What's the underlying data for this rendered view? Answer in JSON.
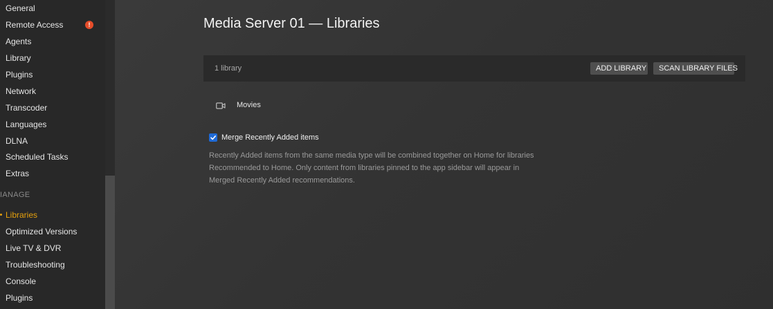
{
  "sidebar": {
    "items": [
      {
        "label": "General"
      },
      {
        "label": "Remote Access",
        "badge": "!"
      },
      {
        "label": "Agents"
      },
      {
        "label": "Library"
      },
      {
        "label": "Plugins"
      },
      {
        "label": "Network"
      },
      {
        "label": "Transcoder"
      },
      {
        "label": "Languages"
      },
      {
        "label": "DLNA"
      },
      {
        "label": "Scheduled Tasks"
      },
      {
        "label": "Extras"
      }
    ],
    "section_header": "IANAGE",
    "manage_items": [
      {
        "label": "Libraries",
        "active": true
      },
      {
        "label": "Optimized Versions"
      },
      {
        "label": "Live TV & DVR"
      },
      {
        "label": "Troubleshooting"
      },
      {
        "label": "Console"
      },
      {
        "label": "Plugins"
      }
    ]
  },
  "main": {
    "title": "Media Server 01 — Libraries",
    "library_count": "1 library",
    "add_library_label": "ADD LIBRARY",
    "scan_library_label": "SCAN LIBRARY FILES",
    "libraries": [
      {
        "name": "Movies",
        "icon": "video-camera-icon"
      }
    ],
    "merge_checkbox_label": "Merge Recently Added items",
    "merge_checked": true,
    "merge_description_lines": [
      "Recently Added items from the same media type will be combined together on Home for libraries",
      "Recommended to Home. Only content from libraries pinned to the app sidebar will appear in",
      "Merged Recently Added recommendations."
    ]
  },
  "colors": {
    "accent": "#e5a00d",
    "alert": "#e64d2a",
    "checkbox": "#1f6ad6",
    "sidebar_bg": "#282828",
    "main_bg": "#333333"
  }
}
